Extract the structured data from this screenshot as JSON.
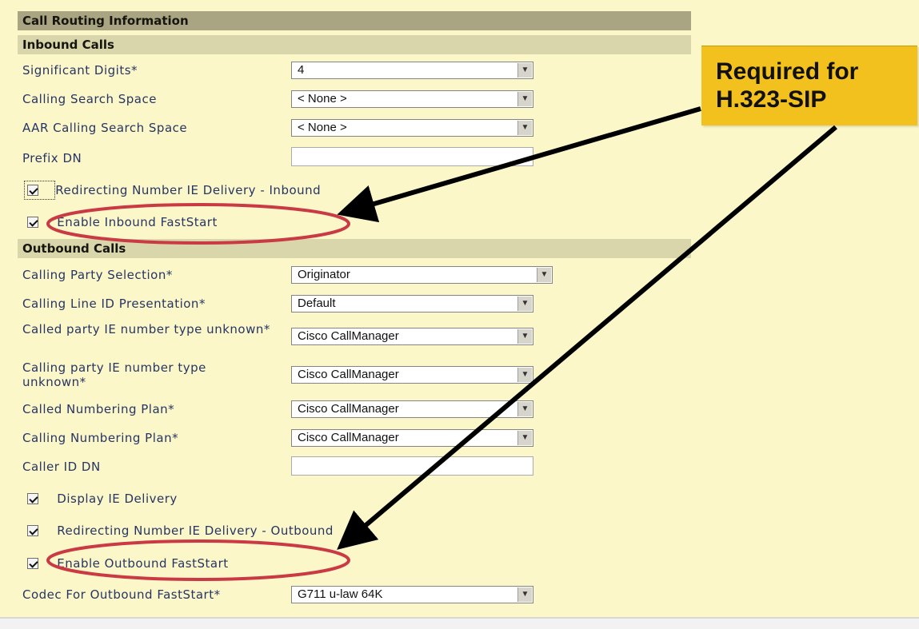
{
  "headers": {
    "call_routing": "Call Routing Information",
    "inbound": "Inbound Calls",
    "outbound": "Outbound Calls"
  },
  "inbound_fields": [
    {
      "label": "Significant Digits*",
      "value": "4"
    },
    {
      "label": "Calling Search Space",
      "value": "< None >"
    },
    {
      "label": "AAR Calling Search Space",
      "value": "< None >"
    },
    {
      "label": "Prefix DN",
      "value": ""
    }
  ],
  "inbound_checks": [
    {
      "label": "Redirecting Number IE Delivery - Inbound",
      "checked": true
    },
    {
      "label": "Enable Inbound FastStart",
      "checked": true
    }
  ],
  "outbound_fields": [
    {
      "label": "Calling Party Selection*",
      "value": "Originator"
    },
    {
      "label": "Calling Line ID Presentation*",
      "value": "Default"
    },
    {
      "label": "Called party IE number type unknown*",
      "value": "Cisco CallManager"
    },
    {
      "label": "Calling party IE number type unknown*",
      "value": "Cisco CallManager"
    },
    {
      "label": "Called Numbering Plan*",
      "value": "Cisco CallManager"
    },
    {
      "label": "Calling Numbering Plan*",
      "value": "Cisco CallManager"
    },
    {
      "label": "Caller ID DN",
      "value": ""
    }
  ],
  "outbound_checks": [
    {
      "label": "Display IE Delivery",
      "checked": true
    },
    {
      "label": "Redirecting Number IE Delivery - Outbound",
      "checked": true
    },
    {
      "label": "Enable Outbound FastStart",
      "checked": true
    }
  ],
  "codec": {
    "label": "Codec For Outbound FastStart*",
    "value": "G711 u-law 64K"
  },
  "callout": {
    "line1": "Required for",
    "line2": "H.323-SIP"
  },
  "colors": {
    "header_dark": "#a9a582",
    "header_light": "#d9d6ab",
    "label_text": "#263564",
    "callout_bg": "#f2c11d",
    "highlight_ellipse": "#c93a44",
    "arrow": "#000000"
  }
}
